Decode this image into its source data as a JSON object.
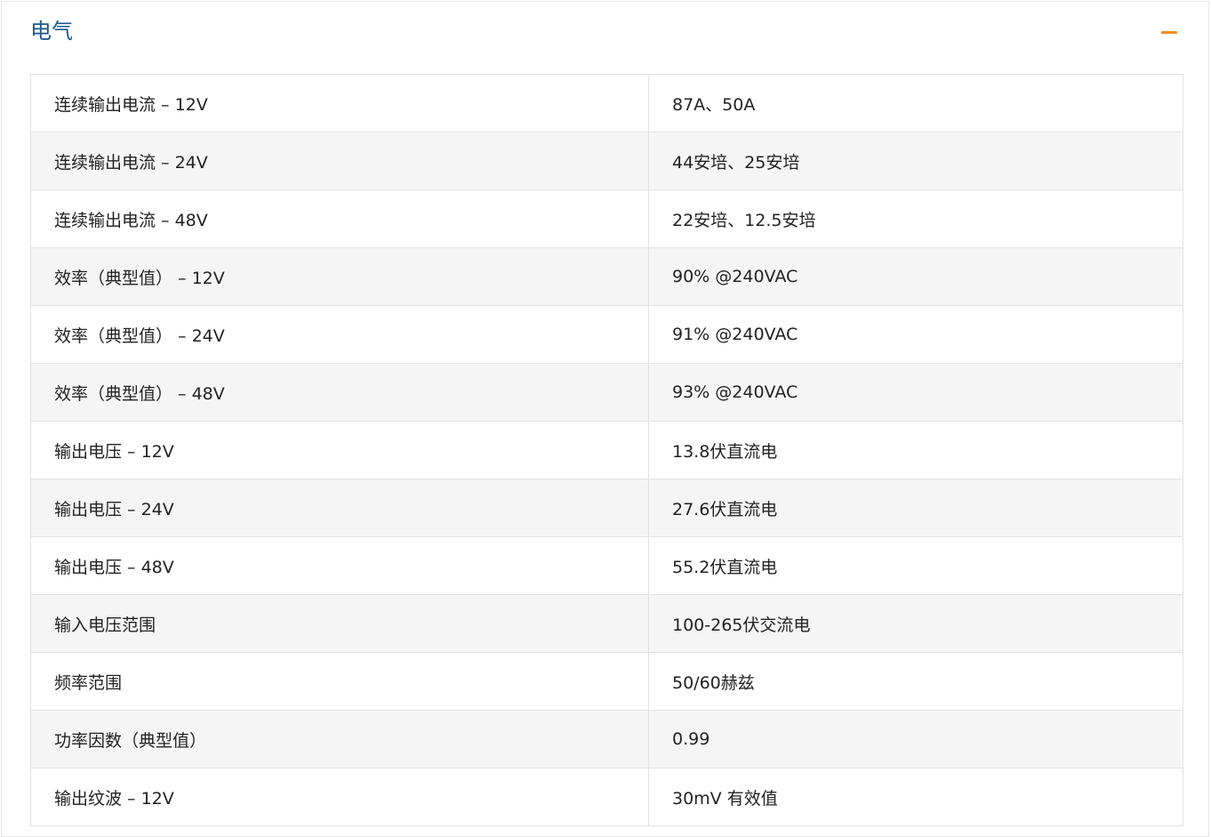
{
  "section": {
    "title": "电气",
    "collapse_icon": "minus-icon",
    "accent_color": "#f08a24",
    "title_color": "#1d5a8e"
  },
  "specs": [
    {
      "label": "连续输出电流 – 12V",
      "value": "87A、50A"
    },
    {
      "label": "连续输出电流 – 24V",
      "value": "44安培、25安培"
    },
    {
      "label": "连续输出电流 – 48V",
      "value": "22安培、12.5安培"
    },
    {
      "label": "效率（典型值） – 12V",
      "value": "90% @240VAC"
    },
    {
      "label": "效率（典型值） – 24V",
      "value": "91% @240VAC"
    },
    {
      "label": "效率（典型值） – 48V",
      "value": "93% @240VAC"
    },
    {
      "label": "输出电压 – 12V",
      "value": "13.8伏直流电"
    },
    {
      "label": "输出电压 – 24V",
      "value": "27.6伏直流电"
    },
    {
      "label": "输出电压 – 48V",
      "value": "55.2伏直流电"
    },
    {
      "label": "输入电压范围",
      "value": "100-265伏交流电"
    },
    {
      "label": "频率范围",
      "value": "50/60赫兹"
    },
    {
      "label": "功率因数（典型值）",
      "value": "0.99"
    },
    {
      "label": "输出纹波 – 12V",
      "value": "30mV 有效值"
    }
  ]
}
